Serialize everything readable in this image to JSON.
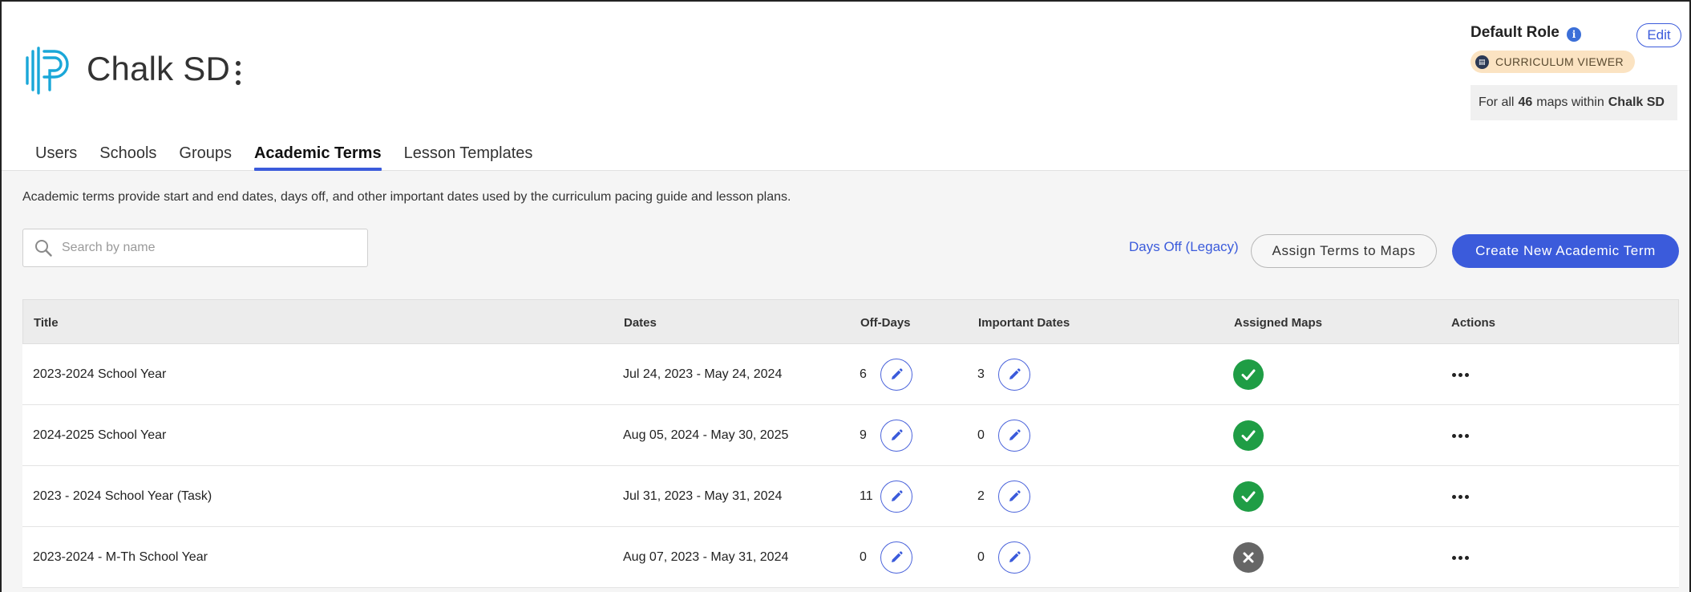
{
  "org": {
    "name": "Chalk SD"
  },
  "tabs": [
    {
      "label": "Users"
    },
    {
      "label": "Schools"
    },
    {
      "label": "Groups"
    },
    {
      "label": "Academic Terms",
      "active": true
    },
    {
      "label": "Lesson Templates"
    }
  ],
  "role": {
    "title": "Default Role",
    "info_glyph": "i",
    "edit_label": "Edit",
    "badge_label": "CURRICULUM VIEWER",
    "badge_icon_glyph": "▤",
    "maps_prefix": "For all",
    "maps_count": "46",
    "maps_middle": "maps within",
    "maps_org": "Chalk SD"
  },
  "description": "Academic terms provide start and end dates, days off, and other important dates used by the curriculum pacing guide and lesson plans.",
  "search": {
    "placeholder": "Search by name",
    "value": ""
  },
  "actions": {
    "legacy_link": "Days Off (Legacy)",
    "assign_label": "Assign Terms to Maps",
    "create_label": "Create New Academic Term"
  },
  "table": {
    "headers": {
      "title": "Title",
      "dates": "Dates",
      "off_days": "Off-Days",
      "important_dates": "Important Dates",
      "assigned_maps": "Assigned Maps",
      "actions": "Actions"
    },
    "rows": [
      {
        "title": "2023-2024 School Year",
        "dates": "Jul 24, 2023 - May 24, 2024",
        "off_days": "6",
        "important_dates": "3",
        "assigned": true
      },
      {
        "title": "2024-2025 School Year",
        "dates": "Aug 05, 2024 - May 30, 2025",
        "off_days": "9",
        "important_dates": "0",
        "assigned": true
      },
      {
        "title": "2023 - 2024 School Year (Task)",
        "dates": "Jul 31, 2023 - May 31, 2024",
        "off_days": "11",
        "important_dates": "2",
        "assigned": true
      },
      {
        "title": "2023-2024 - M-Th School Year",
        "dates": "Aug 07, 2023 - May 31, 2024",
        "off_days": "0",
        "important_dates": "0",
        "assigned": false
      }
    ]
  },
  "colors": {
    "accent": "#3b5bdb",
    "success": "#1f9d45",
    "muted": "#666666",
    "badge_bg": "#fbe3c2",
    "logo": "#1aa7d8"
  },
  "icons": {
    "logo": "chalk-logo-icon",
    "search": "search-icon",
    "edit": "pencil-icon",
    "assigned": "check-circle-icon",
    "unassigned": "x-circle-icon",
    "row_actions": "more-horizontal-icon"
  }
}
